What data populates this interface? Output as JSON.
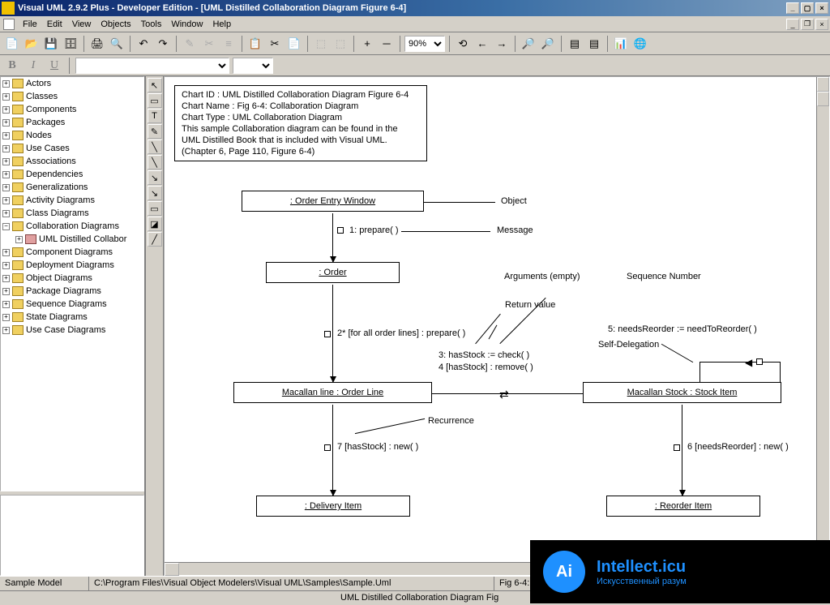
{
  "title": "Visual UML 2.9.2 Plus - Developer Edition - [UML Distilled Collaboration Diagram Figure 6-4]",
  "menu": [
    "File",
    "Edit",
    "View",
    "Objects",
    "Tools",
    "Window",
    "Help"
  ],
  "zoom": "90%",
  "fmt": {
    "bold": "B",
    "italic": "I",
    "underline": "U"
  },
  "tree": [
    "Actors",
    "Classes",
    "Components",
    "Packages",
    "Nodes",
    "Use Cases",
    "Associations",
    "Dependencies",
    "Generalizations",
    "Activity Diagrams",
    "Class Diagrams",
    "Collaboration Diagrams"
  ],
  "tree_child": "UML Distilled Collabor",
  "tree_after": [
    "Component Diagrams",
    "Deployment Diagrams",
    "Object Diagrams",
    "Package Diagrams",
    "Sequence Diagrams",
    "State Diagrams",
    "Use Case Diagrams"
  ],
  "info": {
    "l1": "Chart ID : UML Distilled Collaboration Diagram Figure 6-4",
    "l2": "Chart Name : Fig 6-4: Collaboration Diagram",
    "l3": "Chart Type : UML Collaboration Diagram",
    "l4": "This sample Collaboration diagram can be found in the",
    "l5": "UML Distilled Book that is included with Visual UML.",
    "l6": "(Chapter 6, Page 110, Figure 6-4)"
  },
  "objects": {
    "entry": ": Order Entry Window",
    "order": ": Order",
    "orderline": "Macallan line : Order Line",
    "stockitem": "Macallan Stock : Stock Item",
    "delivery": ": Delivery Item",
    "reorder": ": Reorder Item"
  },
  "labels": {
    "object": "Object",
    "message": "Message",
    "args": "Arguments (empty)",
    "seqnum": "Sequence Number",
    "retval": "Return value",
    "selfdel": "Self-Delegation",
    "recur": "Recurrence",
    "m1": "1: prepare( )",
    "m2": "2* [for all order lines] : prepare( )",
    "m3": "3: hasStock := check( )",
    "m4": "4 [hasStock] : remove( )",
    "m5": "5: needsReorder := needToReorder( )",
    "m6": "6 [needsReorder] : new( )",
    "m7": "7 [hasStock] : new( )"
  },
  "status": {
    "model": "Sample Model",
    "path": "C:\\Program Files\\Visual Object Modelers\\Visual UML\\Samples\\Sample.Uml",
    "chart": "Fig 6-4: Collaboration Diagram",
    "chart2": "UML Distilled Collaboration Diagram Fig"
  },
  "watermark": {
    "logo": "Ai",
    "name": "Intellect.icu",
    "sub": "Искусственный разум"
  }
}
